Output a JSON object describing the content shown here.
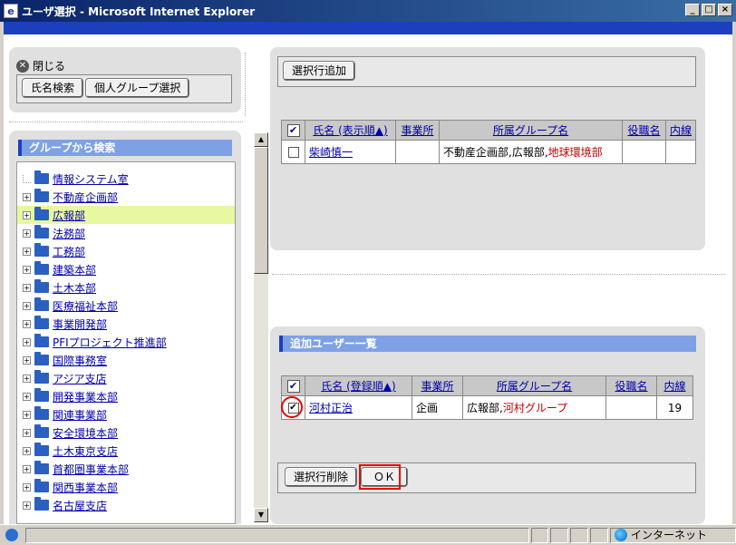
{
  "window": {
    "title": "ユーザ選択 - Microsoft Internet Explorer",
    "min": "_",
    "max": "□",
    "close": "×"
  },
  "left": {
    "close_label": "閉じる",
    "name_search_label": "氏名検索",
    "personal_group_label": "個人グループ選択",
    "group_search_title": "グループから検索",
    "tree": [
      {
        "label": "情報システム室",
        "expandable": false,
        "selected": false
      },
      {
        "label": "不動産企画部",
        "expandable": true,
        "selected": false
      },
      {
        "label": "広報部",
        "expandable": true,
        "selected": true
      },
      {
        "label": "法務部",
        "expandable": true,
        "selected": false
      },
      {
        "label": "工務部",
        "expandable": true,
        "selected": false
      },
      {
        "label": "建築本部",
        "expandable": true,
        "selected": false
      },
      {
        "label": "土木本部",
        "expandable": true,
        "selected": false
      },
      {
        "label": "医療福祉本部",
        "expandable": true,
        "selected": false
      },
      {
        "label": "事業開発部",
        "expandable": true,
        "selected": false
      },
      {
        "label": "PFIプロジェクト推進部",
        "expandable": true,
        "selected": false
      },
      {
        "label": "国際事務室",
        "expandable": true,
        "selected": false
      },
      {
        "label": "アジア支店",
        "expandable": true,
        "selected": false
      },
      {
        "label": "開発事業本部",
        "expandable": true,
        "selected": false
      },
      {
        "label": "関連事業部",
        "expandable": true,
        "selected": false
      },
      {
        "label": "安全環境本部",
        "expandable": true,
        "selected": false
      },
      {
        "label": "土木東京支店",
        "expandable": true,
        "selected": false
      },
      {
        "label": "首都圏事業本部",
        "expandable": true,
        "selected": false
      },
      {
        "label": "関西事業本部",
        "expandable": true,
        "selected": false
      },
      {
        "label": "名古屋支店",
        "expandable": true,
        "selected": false
      }
    ]
  },
  "right": {
    "add_selected_label": "選択行追加",
    "top_table": {
      "headers": {
        "name": "氏名 (表示順▲)",
        "office": "事業所",
        "group": "所属グループ名",
        "title": "役職名",
        "ext": "内線"
      },
      "row": {
        "checked": false,
        "name": "柴崎慎一",
        "office": "",
        "group_prefix": "不動産企画部,広報部,",
        "group_red": "地球環境部",
        "title": "",
        "ext": ""
      }
    },
    "added_users_title": "追加ユーザー一覧",
    "bottom_table": {
      "headers": {
        "name": "氏名 (登録順▲)",
        "office": "事業所",
        "group": "所属グループ名",
        "title": "役職名",
        "ext": "内線"
      },
      "row": {
        "checked": true,
        "name": "河村正治",
        "office": "企画",
        "group_prefix": "広報部,",
        "group_red": "河村グループ",
        "title": "",
        "ext": "19"
      }
    },
    "delete_selected_label": "選択行削除",
    "ok_label": "ＯＫ"
  },
  "status": {
    "zone": "インターネット"
  },
  "colors": {
    "titlebar": "#0a246a",
    "section_header": "#7ea1e6",
    "selected_row": "#e8f8a0",
    "highlight_ring": "#e00000"
  }
}
